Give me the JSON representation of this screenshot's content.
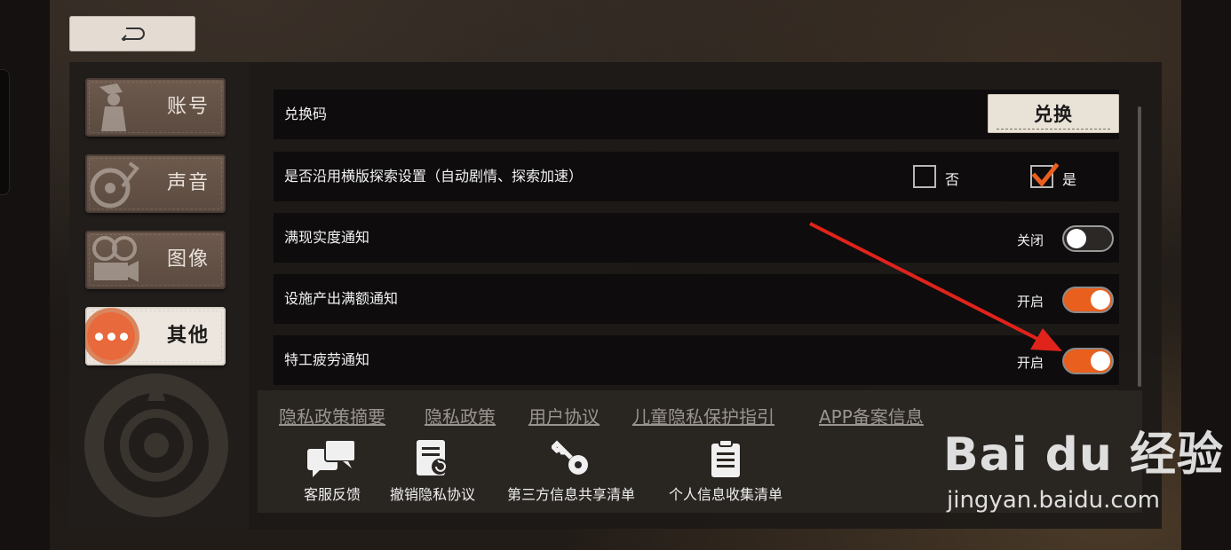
{
  "back_button": {
    "icon": "back-arrow-icon"
  },
  "sidebar": {
    "tabs": [
      {
        "label": "账号",
        "icon": "account-figure-icon",
        "active": false
      },
      {
        "label": "声音",
        "icon": "record-player-icon",
        "active": false
      },
      {
        "label": "图像",
        "icon": "film-projector-icon",
        "active": false
      },
      {
        "label": "其他",
        "icon": "more-dots-icon",
        "active": true
      }
    ]
  },
  "settings": {
    "redeem_code": {
      "label": "兑换码",
      "button_label": "兑换"
    },
    "explore_setting": {
      "label": "是否沿用横版探索设置（自动剧情、探索加速）",
      "options": [
        {
          "label": "否",
          "checked": false
        },
        {
          "label": "是",
          "checked": true
        }
      ]
    },
    "toggles": [
      {
        "label": "满现实度通知",
        "state_label": "关闭",
        "on": false
      },
      {
        "label": "设施产出满额通知",
        "state_label": "开启",
        "on": true
      },
      {
        "label": "特工疲劳通知",
        "state_label": "开启",
        "on": true
      }
    ]
  },
  "footer": {
    "links": [
      "隐私政策摘要",
      "隐私政策",
      "用户协议",
      "儿童隐私保护指引",
      "APP备案信息"
    ],
    "actions": [
      {
        "label": "客服反馈",
        "icon": "chat-bubbles-icon"
      },
      {
        "label": "撤销隐私协议",
        "icon": "document-revoke-icon"
      },
      {
        "label": "第三方信息共享清单",
        "icon": "key-icon"
      },
      {
        "label": "个人信息收集清单",
        "icon": "clipboard-icon"
      }
    ]
  },
  "watermark": {
    "brand": "Bai du 经验",
    "url": "jingyan.baidu.com"
  },
  "colors": {
    "accent": "#e85f1e",
    "arrow": "#e0231b",
    "panel": "#1c1917"
  }
}
